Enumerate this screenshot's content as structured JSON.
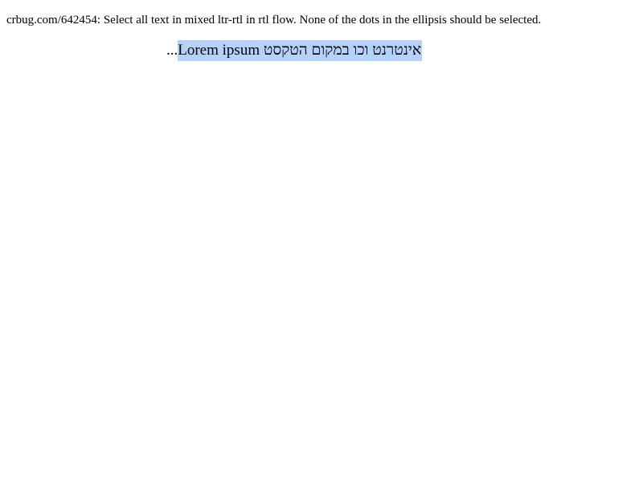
{
  "instructions": "crbug.com/642454: Select all text in mixed ltr-rtl in rtl flow. None of the dots in the ellipsis should be selected.",
  "test_line": {
    "ellipsis": "...",
    "selected_text": "אינטרנט וכו במקום הטקסט Lorem ipsum",
    "selection_color": "#b4d2fc"
  }
}
